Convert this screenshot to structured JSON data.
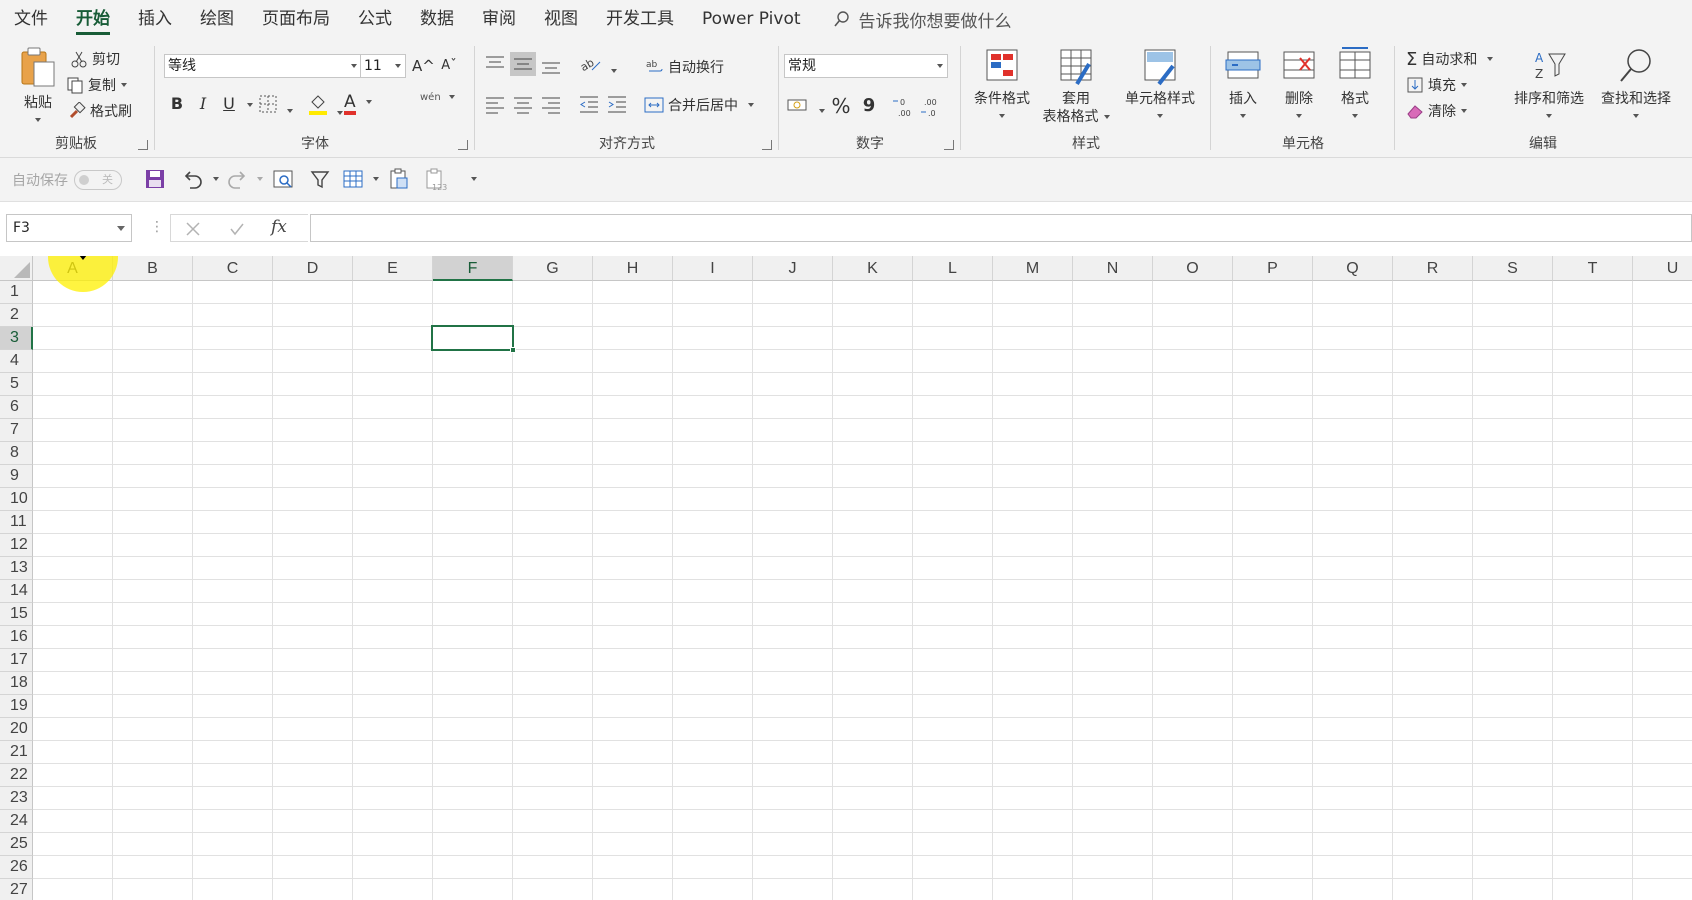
{
  "tabs": [
    "文件",
    "开始",
    "插入",
    "绘图",
    "页面布局",
    "公式",
    "数据",
    "审阅",
    "视图",
    "开发工具",
    "Power Pivot"
  ],
  "active_tab": "开始",
  "tell_me": "告诉我你想要做什么",
  "ribbon": {
    "clipboard": {
      "label": "剪贴板",
      "paste": "粘贴",
      "cut": "剪切",
      "copy": "复制",
      "format_painter": "格式刷"
    },
    "font": {
      "label": "字体",
      "font_name": "等线",
      "font_size": "11",
      "grow": "A^",
      "shrink": "Aˇ",
      "bold": "B",
      "italic": "I",
      "underline": "U",
      "phonetic": "wén",
      "font_color_letter": "A"
    },
    "alignment": {
      "label": "对齐方式",
      "wrap": "自动换行",
      "merge": "合并后居中"
    },
    "number": {
      "label": "数字",
      "format": "常规",
      "percent": "%",
      "comma": "9"
    },
    "styles": {
      "label": "样式",
      "conditional": "条件格式",
      "table_line1": "套用",
      "table_line2": "表格格式",
      "cell_styles": "单元格样式"
    },
    "cells": {
      "label": "单元格",
      "insert": "插入",
      "delete": "删除",
      "format": "格式"
    },
    "editing": {
      "label": "编辑",
      "autosum": "自动求和",
      "fill": "填充",
      "clear": "清除",
      "sort": "排序和筛选",
      "find": "查找和选择"
    }
  },
  "qat": {
    "autosave": "自动保存",
    "toggle_state": "关"
  },
  "formula_bar": {
    "name_box": "F3",
    "fx": "fx",
    "value": ""
  },
  "columns": [
    "A",
    "B",
    "C",
    "D",
    "E",
    "F",
    "G",
    "H",
    "I",
    "J",
    "K",
    "L",
    "M",
    "N",
    "O",
    "P",
    "Q",
    "R",
    "S",
    "T",
    "U"
  ],
  "rows": [
    "1",
    "2",
    "3",
    "4",
    "5",
    "6",
    "7",
    "8",
    "9",
    "10",
    "11",
    "12",
    "13",
    "14",
    "15",
    "16",
    "17",
    "18",
    "19",
    "20",
    "21",
    "22",
    "23",
    "24",
    "25",
    "26",
    "27"
  ],
  "selected_cell": {
    "column": "F",
    "row": "3"
  },
  "colors": {
    "accent": "#217346",
    "tab_active": "#185c37",
    "highlight": "#fff000"
  }
}
